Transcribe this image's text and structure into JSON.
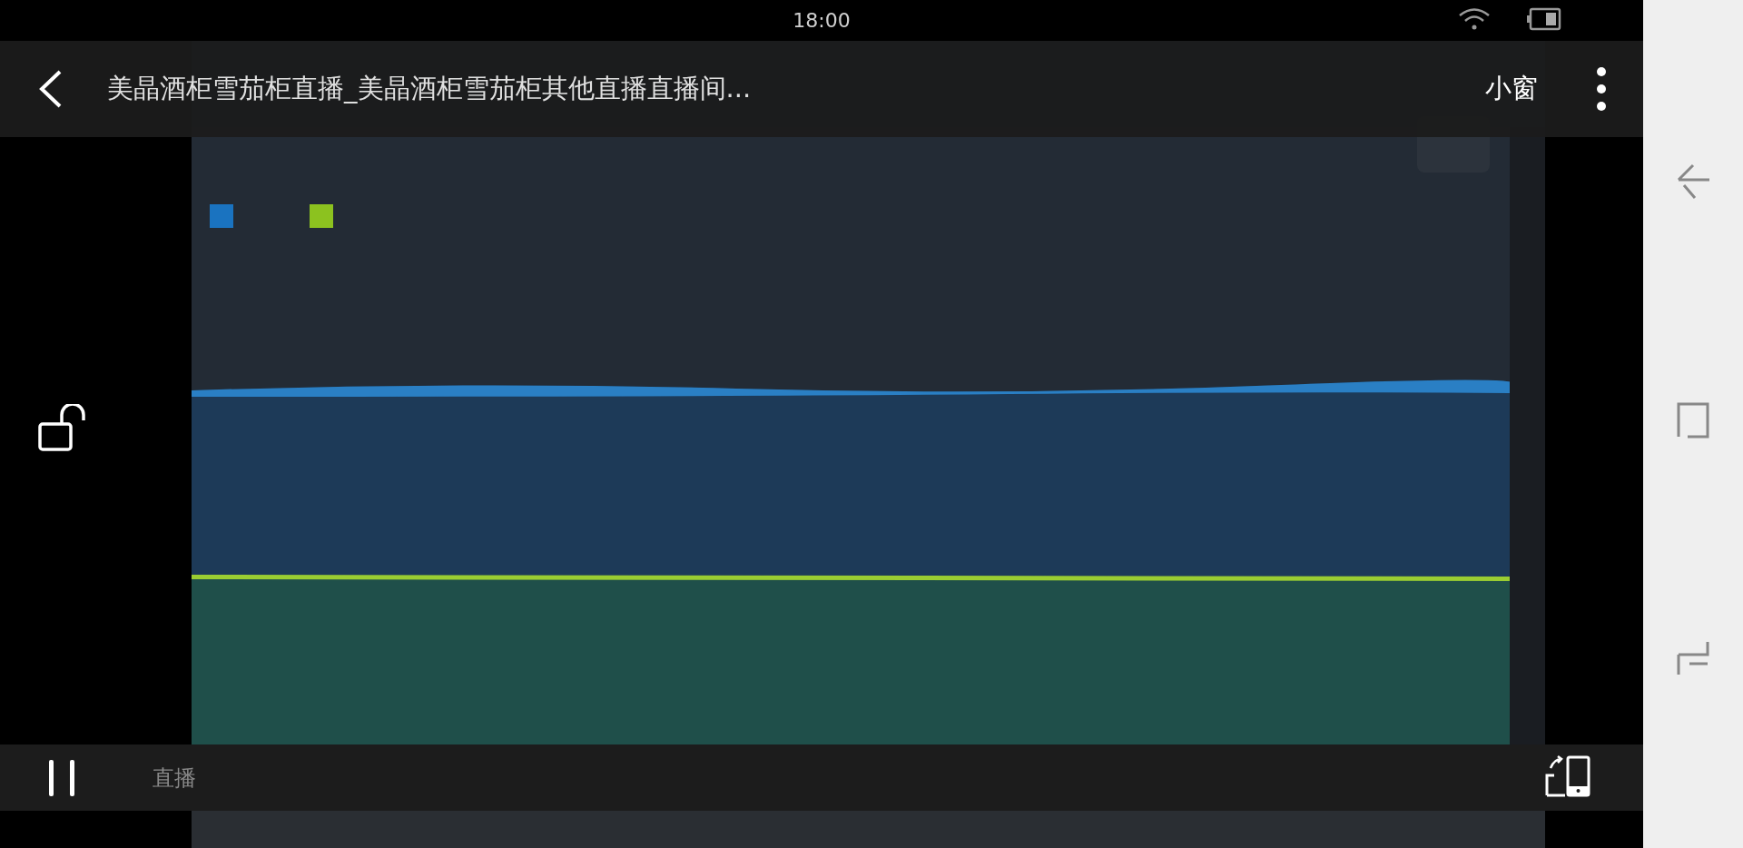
{
  "status_bar": {
    "time": "18:00"
  },
  "title_bar": {
    "title": "美晶酒柜雪茄柜直播_美晶酒柜雪茄柜其他直播直播间...",
    "mini_window": "小窗"
  },
  "controls": {
    "live_label": "直播"
  }
}
